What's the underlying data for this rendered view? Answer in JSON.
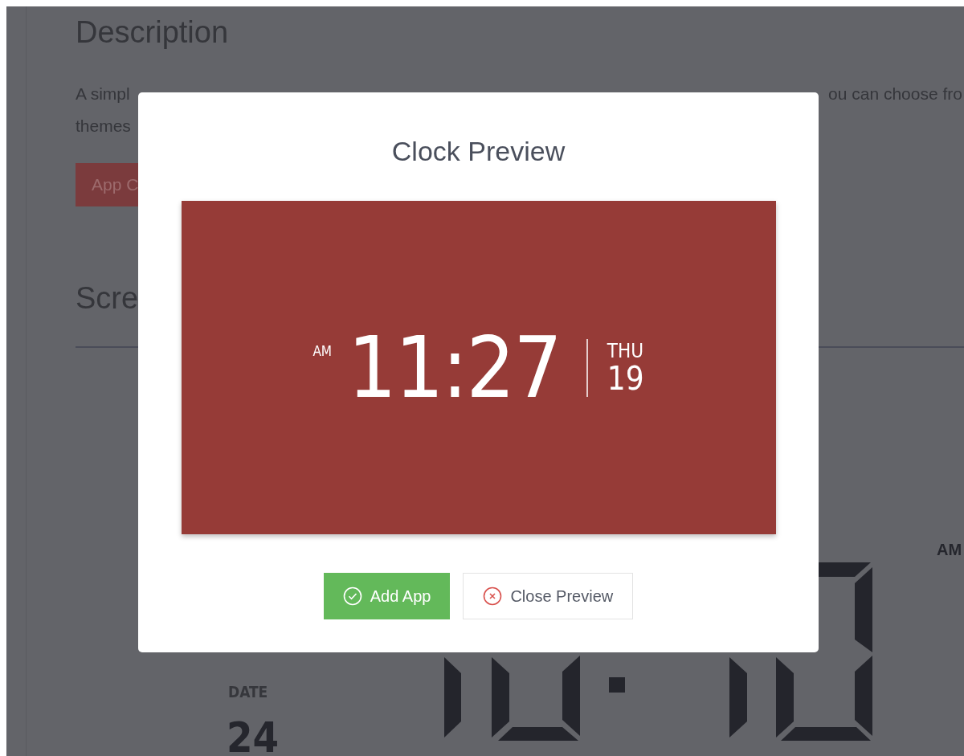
{
  "background_page": {
    "heading": "Description",
    "description_line_1_left": "A simpl",
    "description_line_1_right": "ou can choose fro",
    "description_line_2": "themes",
    "button": "App C",
    "section_heading": "Scre",
    "preview_meridiem": "AM",
    "date_label": "DATE",
    "date_value": "24"
  },
  "modal": {
    "title": "Clock Preview",
    "clock": {
      "meridiem": "AM",
      "time": "11:27",
      "weekday": "THU",
      "day": "19"
    },
    "buttons": [
      {
        "label": "Add App",
        "kind": "primary"
      },
      {
        "label": "Close Preview",
        "kind": "secondary"
      }
    ]
  }
}
